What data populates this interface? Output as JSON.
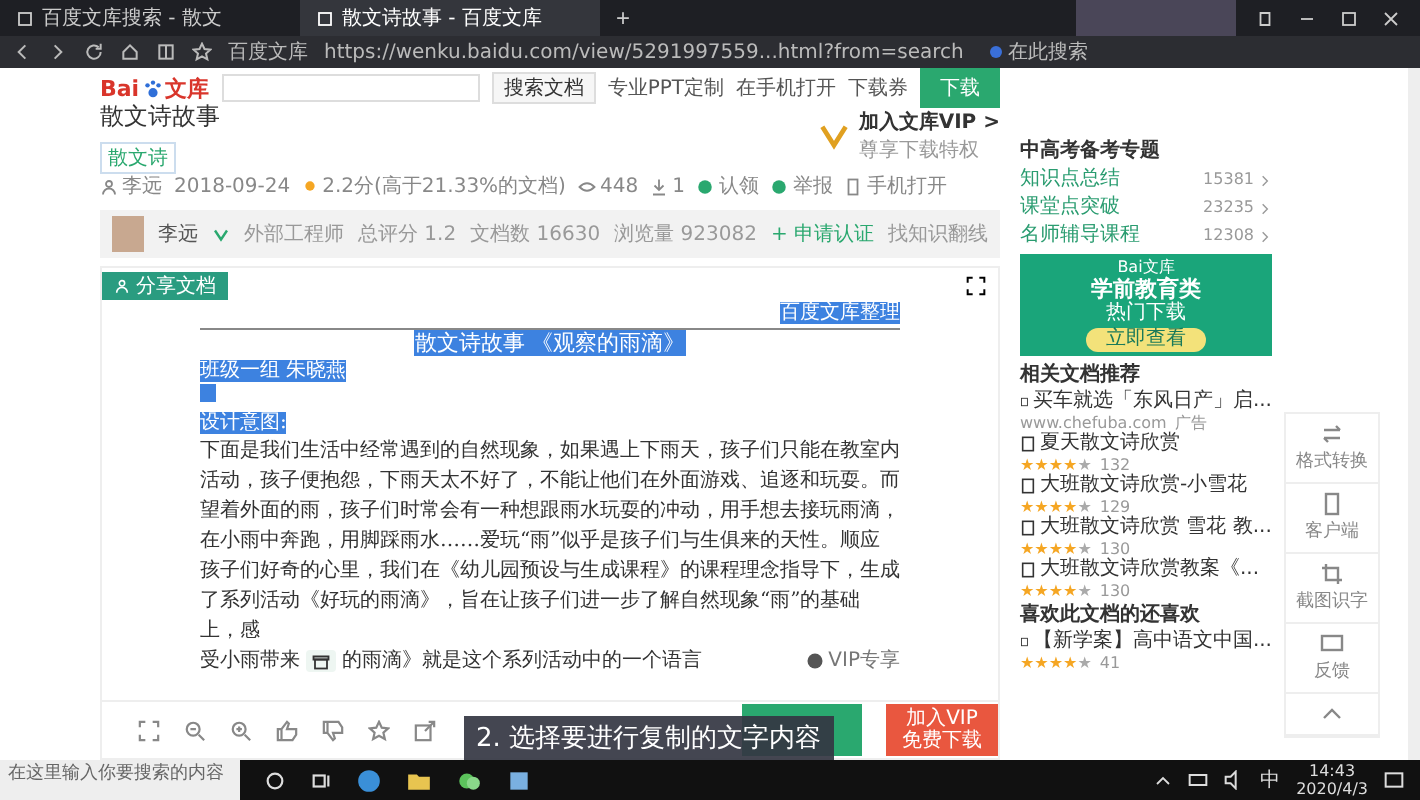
{
  "browser": {
    "tabs": [
      {
        "label": "百度文库搜索 - 散文",
        "selected": false
      },
      {
        "label": "散文诗故事 - 百度文库",
        "selected": true
      }
    ],
    "new_tab": "+",
    "bookmark": "百度文库",
    "url": "https://wenku.baidu.com/view/5291997559...html?from=search",
    "search_label": "在此搜索"
  },
  "header": {
    "logo": {
      "left": "Bai",
      "right": "文库"
    },
    "search_button": "搜索文档",
    "links": [
      "专业PPT定制",
      "在手机打开"
    ],
    "coupon": "下载券",
    "download": "下载"
  },
  "document": {
    "title": "散文诗故事",
    "tag": "散文诗",
    "vip": {
      "title": "加入文库VIP >",
      "subtitle": "尊享下载特权"
    },
    "meta": {
      "author": "李远",
      "date": "2018-09-24",
      "score": "2.2分(高于21.33%的文档)",
      "views": "448",
      "downloads": "1",
      "claim": "认领",
      "report": "举报",
      "mobile": "手机打开"
    }
  },
  "uploader": {
    "name": "李远",
    "role": "外部工程师",
    "rating": "总评分 1.2",
    "docs": "文档数 16630",
    "visits": "浏览量 923082",
    "apply": "+ 申请认证",
    "link": "找知识翻线"
  },
  "reader": {
    "badge": "分享文档",
    "lines": [
      {
        "kind": "note",
        "text": "百度文库整理",
        "highlighted": true
      },
      {
        "kind": "heading",
        "text": "散文诗故事 《观察的雨滴》",
        "highlighted": true
      },
      {
        "kind": "byline",
        "text": "班级一组 朱晓燕",
        "highlighted": true
      },
      {
        "kind": "blank",
        "highlighted": true
      },
      {
        "kind": "section",
        "text": "设计意图:",
        "highlighted": true
      },
      {
        "kind": "body",
        "text": "下面是我们生活中经常遇到的自然现象，如果遇上下雨天，孩子们只能在教室内活动，孩子便抱怨，下雨天太不好了，不能让他们在外面游戏、追逐和玩耍。而望着外面的雨，孩子们时常会有一种想跟雨水玩耍的冲动，用手想去接玩雨滴，在小雨中奔跑，用脚踩雨水……爱玩“雨”似乎是孩子们与生俱来的天性。顺应孩子们好奇的心里，我们在《幼儿园预设与生成课程》的课程理念指导下，生成了系列活动《好玩的雨滴》，旨在让孩子们进一步了解自然现象“雨”的基础上，感",
        "highlighted": false
      }
    ],
    "last_line": {
      "start": "受小雨带来",
      "end": "的雨滴》就是这个系列活动中的一个语言",
      "vip": "VIP专享"
    },
    "vip_button": {
      "top": "加入VIP",
      "bottom": "免费下载"
    }
  },
  "caption": "2. 选择要进行复制的文字内容",
  "sidebar": {
    "topic_title": "中高考备考专题",
    "topics": [
      {
        "label": "知识点总结",
        "count": "15381"
      },
      {
        "label": "课堂点突破",
        "count": "23235"
      },
      {
        "label": "名师辅导课程",
        "count": "12308"
      }
    ],
    "ad": {
      "brand": "Bai文库",
      "title": "学前教育类",
      "subtitle": "热门下载",
      "button": "立即查看"
    },
    "related_title": "相关文档推荐",
    "related": [
      {
        "kind": "ad",
        "title": "买车就选「东风日产」启...",
        "url": "www.chefuba.com",
        "tag": "广告"
      },
      {
        "kind": "doc",
        "title": "夏天散文诗欣赏",
        "stars": 4,
        "count": "132"
      },
      {
        "kind": "doc",
        "title": "大班散文诗欣赏-小雪花",
        "stars": 4,
        "count": "129"
      },
      {
        "kind": "doc",
        "title": "大班散文诗欣赏 雪花 教...",
        "stars": 4,
        "count": "130"
      },
      {
        "kind": "doc",
        "title": "大班散文诗欣赏教案《...",
        "stars": 4,
        "count": "130"
      }
    ],
    "also_title": "喜欢此文档的还喜欢",
    "also": [
      {
        "kind": "doc",
        "title": "【新学案】高中语文中国...",
        "stars": 4,
        "count": "41"
      }
    ]
  },
  "tools": [
    "格式转换",
    "客户端",
    "截图识字",
    "反馈"
  ],
  "taskbar": {
    "search_placeholder": "在这里输入你要搜索的内容",
    "ime": "中",
    "time": "14:43",
    "date": "2020/4/3"
  }
}
